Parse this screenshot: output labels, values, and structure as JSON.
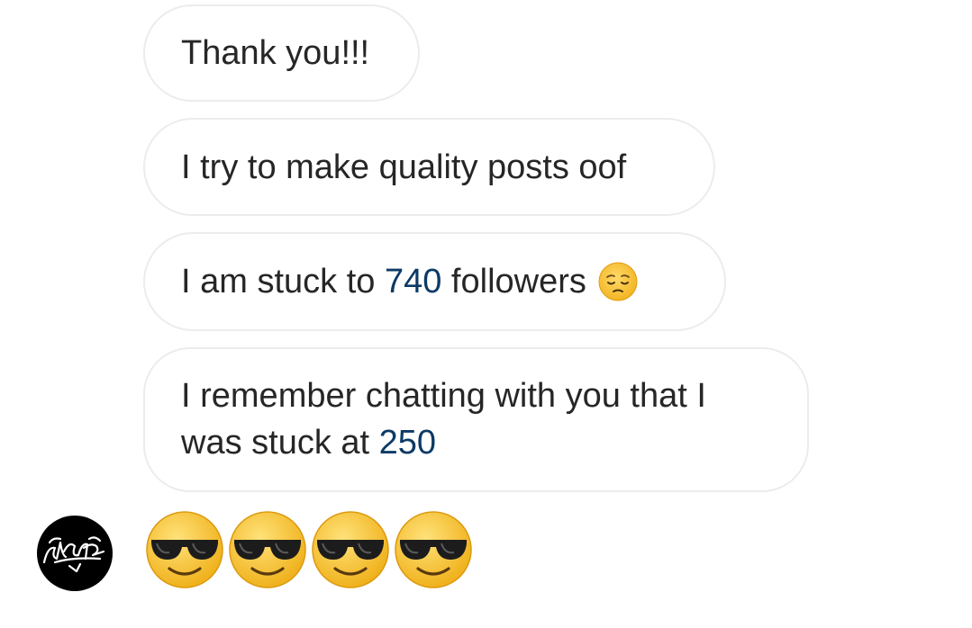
{
  "messages": [
    {
      "text": "Thank you!!!"
    },
    {
      "text": "I try to make quality posts oof"
    },
    {
      "prefix": "I am stuck to ",
      "number": "740",
      "suffix": " followers",
      "emoji": "pensive-face"
    },
    {
      "prefix": "I remember chatting with you that I was stuck at ",
      "number": "250"
    }
  ],
  "reaction_message": {
    "emoji": "smiling-face-with-sunglasses",
    "count": 4
  },
  "avatar": {
    "description": "graffiti-tag-logo"
  },
  "colors": {
    "bubble_border": "#ececec",
    "text": "#262626",
    "number_link": "#0b3a66",
    "avatar_bg": "#000000",
    "emoji_yellow": "#f6c02a"
  }
}
